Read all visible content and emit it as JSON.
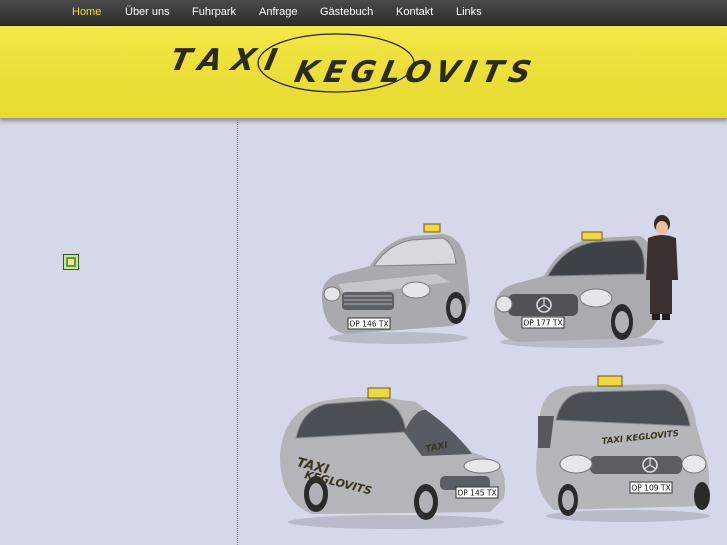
{
  "nav": {
    "items": [
      {
        "label": "Home",
        "active": true
      },
      {
        "label": "Über uns",
        "active": false
      },
      {
        "label": "Fuhrpark",
        "active": false
      },
      {
        "label": "Anfrage",
        "active": false
      },
      {
        "label": "Gästebuch",
        "active": false
      },
      {
        "label": "Kontakt",
        "active": false
      },
      {
        "label": "Links",
        "active": false
      }
    ]
  },
  "banner": {
    "logo_line1": "TAXI",
    "logo_line2": "KEGLOVITS"
  },
  "cars": [
    {
      "name": "silver sedan taxi",
      "plate": "OP 146 TX"
    },
    {
      "name": "silver sedan taxi with driver",
      "plate": "OP 177 TX"
    },
    {
      "name": "silver minivan taxi",
      "plate": "OP 145 TX",
      "door_text_1": "TAXI",
      "door_text_2": "KEGLOVITS"
    },
    {
      "name": "silver van taxi",
      "plate": "OP 109 TX",
      "door_text": "TAXI KEGLOVITS"
    }
  ],
  "colors": {
    "nav_bg": "#3a3a3a",
    "nav_active": "#f2dd2a",
    "banner_yellow": "#ece03a",
    "page_bg": "#d5d8e8",
    "divider": "#4a8ad6"
  }
}
